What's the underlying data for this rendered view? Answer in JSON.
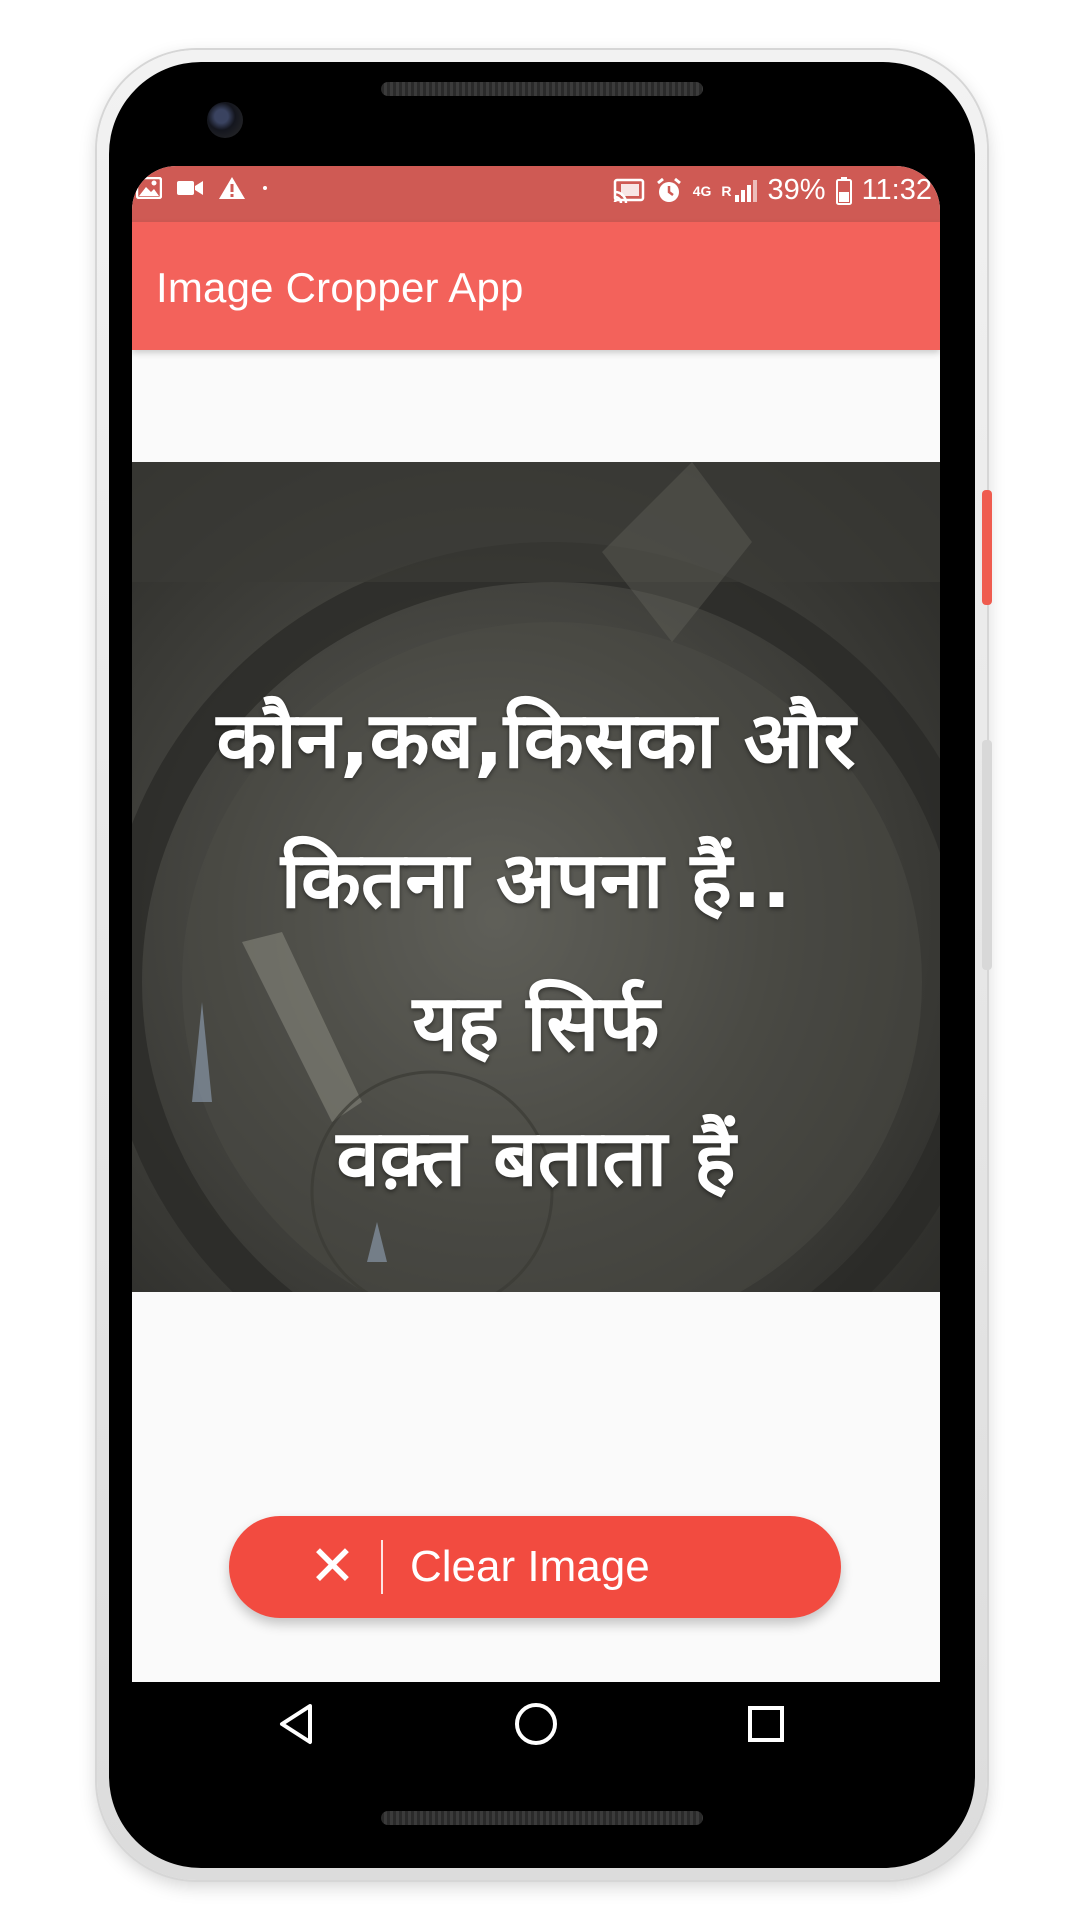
{
  "status_bar": {
    "notification_icons": [
      "image-icon",
      "video-icon",
      "warning-icon",
      "dot-icon"
    ],
    "cast_icon": "cast-icon",
    "alarm_icon": "alarm-icon",
    "network_label": "4G",
    "roaming_label": "R",
    "signal_icon": "signal-icon",
    "battery_percent": "39%",
    "battery_icon": "battery-icon",
    "time": "11:32"
  },
  "app_bar": {
    "title": "Image Cropper App"
  },
  "image": {
    "quote_lines": [
      "कौन,कब,किसका और",
      "कितना अपना हैं..",
      "यह सिर्फ",
      "वक़्त बताता हैं"
    ]
  },
  "fab": {
    "icon": "close-icon",
    "icon_glyph": "✕",
    "label": "Clear Image"
  },
  "nav_bar": {
    "back_icon": "back-icon",
    "home_icon": "home-icon",
    "recents_icon": "recents-icon"
  },
  "colors": {
    "status_bar": "#cf5a54",
    "app_bar": "#f3625b",
    "fab": "#f24b40",
    "screen_background": "#fafafa"
  }
}
